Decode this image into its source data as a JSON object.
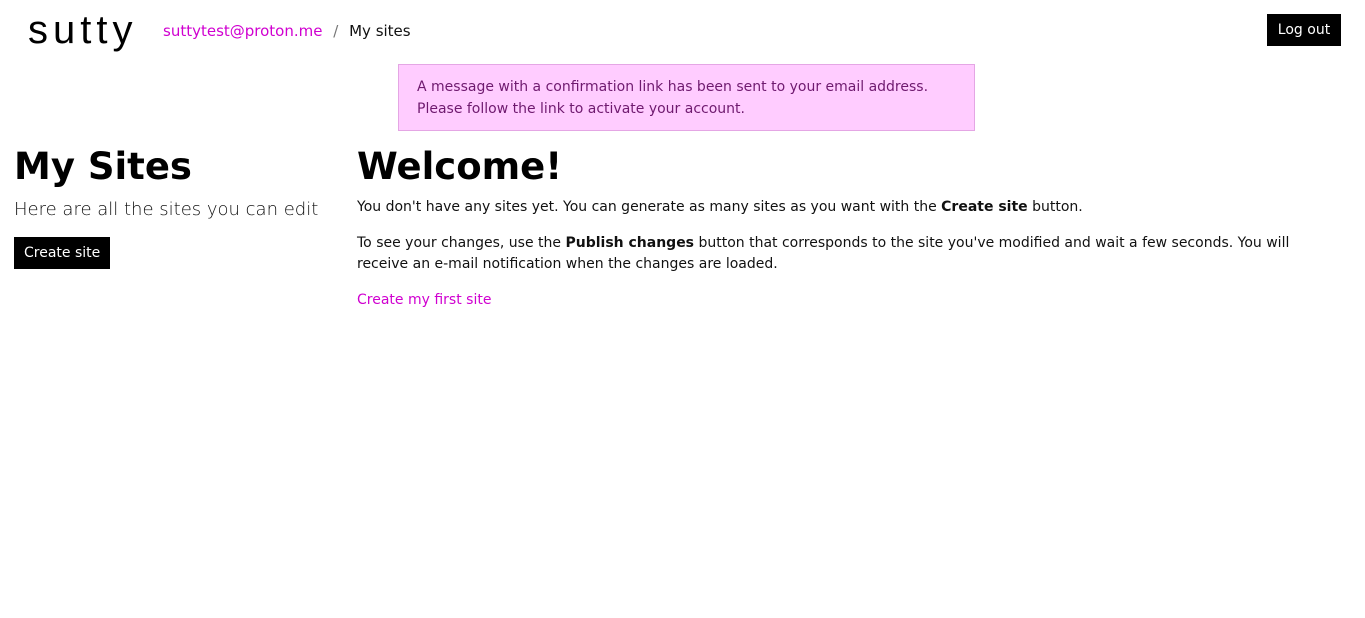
{
  "header": {
    "logo_text": "sutty",
    "breadcrumb": {
      "user_email": "suttytest@proton.me",
      "separator": "/",
      "current": "My sites"
    },
    "logout_label": "Log out"
  },
  "alert": {
    "message": "A message with a confirmation link has been sent to your email address. Please follow the link to activate your account."
  },
  "sidebar": {
    "title": "My Sites",
    "subtitle": "Here are all the sites you can edit",
    "create_site_label": "Create site"
  },
  "main": {
    "title": "Welcome!",
    "paragraph1": {
      "before": "You don't have any sites yet. You can generate as many sites as you want with the ",
      "bold": "Create site",
      "after": " button."
    },
    "paragraph2": {
      "before": "To see your changes, use the ",
      "bold": "Publish changes",
      "after": " button that corresponds to the site you've modified and wait a few seconds. You will receive an e-mail notification when the changes are loaded."
    },
    "first_site_link": "Create my first site"
  },
  "colors": {
    "accent": "#d000d0",
    "alert_background": "#ffccff",
    "alert_text": "#6f1a6f",
    "button_background": "#000000",
    "button_text": "#ffffff"
  }
}
